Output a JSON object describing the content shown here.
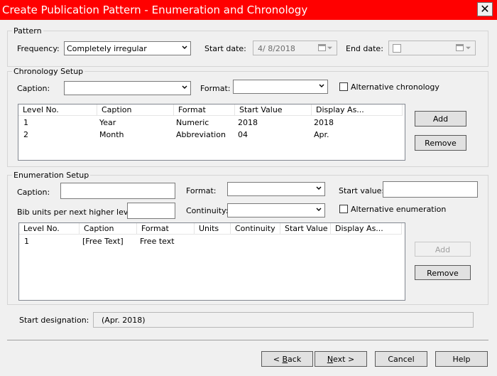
{
  "window": {
    "title": "Create Publication Pattern - Enumeration and Chronology",
    "close_glyph": "✕"
  },
  "pattern": {
    "legend": "Pattern",
    "frequency_label": "Frequency:",
    "frequency_value": "Completely irregular",
    "start_date_label": "Start date:",
    "start_date_value": "4/  8/2018",
    "end_date_label": "End date:"
  },
  "chronology": {
    "legend": "Chronology Setup",
    "caption_label": "Caption:",
    "format_label": "Format:",
    "alt_label": "Alternative chronology",
    "columns": [
      "Level No.",
      "Caption",
      "Format",
      "Start Value",
      "Display As..."
    ],
    "rows": [
      [
        "1",
        "Year",
        "Numeric",
        "2018",
        "2018"
      ],
      [
        "2",
        "Month",
        "Abbreviation",
        "04",
        "Apr."
      ]
    ],
    "add_label": "Add",
    "remove_label": "Remove"
  },
  "enumeration": {
    "legend": "Enumeration Setup",
    "caption_label": "Caption:",
    "format_label": "Format:",
    "start_value_label": "Start value:",
    "bib_units_label": "Bib units per next higher level:",
    "continuity_label": "Continuity:",
    "alt_label": "Alternative enumeration",
    "columns": [
      "Level No.",
      "Caption",
      "Format",
      "Units",
      "Continuity",
      "Start Value",
      "Display As..."
    ],
    "rows": [
      [
        "1",
        "[Free Text]",
        "Free text",
        "",
        "",
        "",
        ""
      ]
    ],
    "add_label": "Add",
    "remove_label": "Remove"
  },
  "start_designation": {
    "label": "Start designation:",
    "value": "(Apr. 2018)"
  },
  "footer": {
    "back_mnemonic": "B",
    "back_rest": "ack",
    "back_prefix": "< ",
    "next_mnemonic": "N",
    "next_rest": "ext >",
    "cancel_label": "Cancel",
    "help_label": "Help"
  }
}
